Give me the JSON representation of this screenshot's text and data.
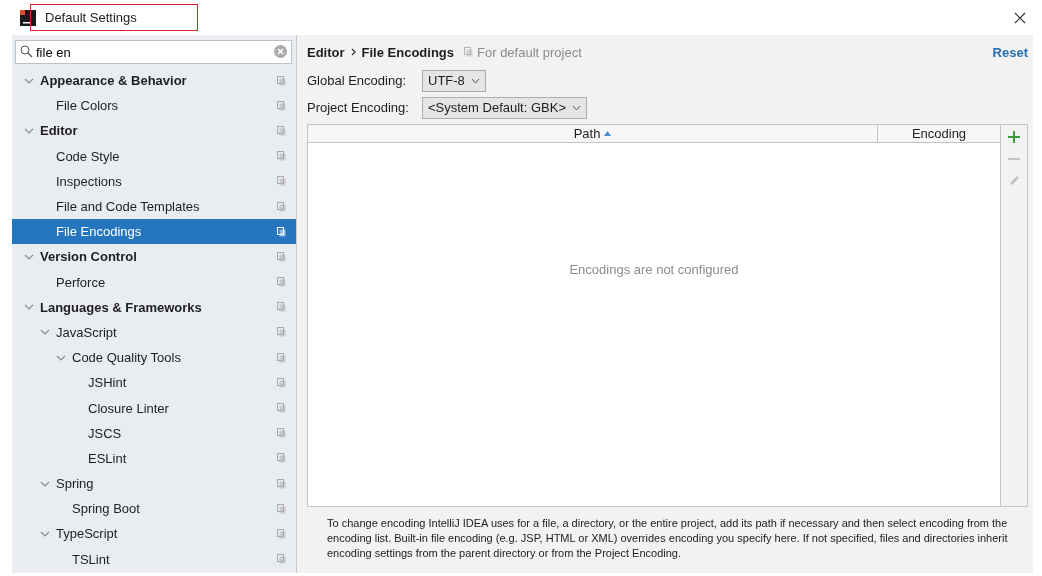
{
  "window": {
    "title": "Default Settings"
  },
  "search": {
    "value": "file en"
  },
  "tree": [
    {
      "label": "Appearance & Behavior",
      "expanded": true,
      "selected": false,
      "children": [
        {
          "label": "File Colors",
          "selected": false
        }
      ]
    },
    {
      "label": "Editor",
      "expanded": true,
      "selected": false,
      "children": [
        {
          "label": "Code Style",
          "selected": false
        },
        {
          "label": "Inspections",
          "selected": false
        },
        {
          "label": "File and Code Templates",
          "selected": false
        },
        {
          "label": "File Encodings",
          "selected": true
        }
      ]
    },
    {
      "label": "Version Control",
      "expanded": true,
      "selected": false,
      "children": [
        {
          "label": "Perforce",
          "selected": false
        }
      ]
    },
    {
      "label": "Languages & Frameworks",
      "expanded": true,
      "selected": false,
      "children": [
        {
          "label": "JavaScript",
          "expanded": true,
          "selected": false,
          "children": [
            {
              "label": "Code Quality Tools",
              "expanded": true,
              "selected": false,
              "children": [
                {
                  "label": "JSHint",
                  "selected": false
                },
                {
                  "label": "Closure Linter",
                  "selected": false
                },
                {
                  "label": "JSCS",
                  "selected": false
                },
                {
                  "label": "ESLint",
                  "selected": false
                }
              ]
            }
          ]
        },
        {
          "label": "Spring",
          "expanded": true,
          "selected": false,
          "children": [
            {
              "label": "Spring Boot",
              "selected": false
            }
          ]
        },
        {
          "label": "TypeScript",
          "expanded": true,
          "selected": false,
          "children": [
            {
              "label": "TSLint",
              "selected": false
            }
          ]
        }
      ]
    }
  ],
  "breadcrumb": [
    "Editor",
    "File Encodings"
  ],
  "scope": "For default project",
  "reset": "Reset",
  "fields": [
    {
      "label": "Global Encoding:",
      "value": "UTF-8"
    },
    {
      "label": "Project Encoding:",
      "value": "<System Default: GBK>"
    }
  ],
  "table": {
    "columns": [
      {
        "label": "Path",
        "sorted": true
      },
      {
        "label": "Encoding",
        "sorted": false
      }
    ],
    "empty_text": "Encodings are not configured"
  },
  "tools": [
    {
      "kind": "add",
      "disabled": false
    },
    {
      "kind": "remove",
      "disabled": true
    },
    {
      "kind": "edit",
      "disabled": true
    }
  ],
  "help": "To change encoding IntelliJ IDEA uses for a file, a directory, or the entire project, add its path if necessary and then select encoding from the encoding list. Built-in file encoding (e.g. JSP, HTML or XML) overrides encoding you specify here. If not specified, files and directories inherit encoding settings from the parent directory or from the Project Encoding."
}
